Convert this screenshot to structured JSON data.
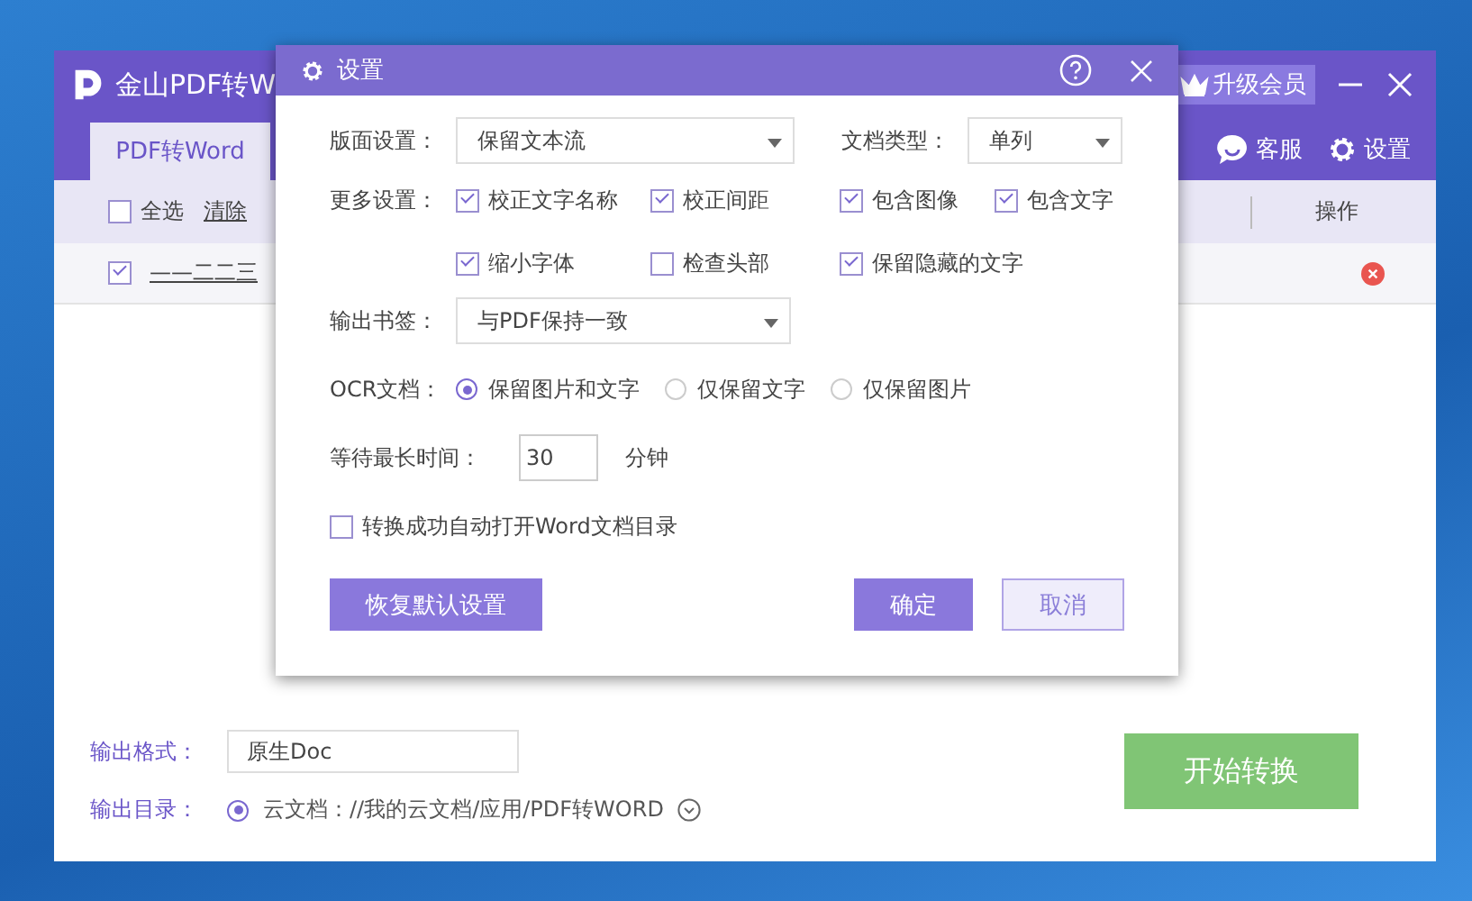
{
  "app": {
    "title": "金山PDF转W",
    "upgrade_label": "升级会员",
    "tabs": [
      {
        "label": "PDF转Word",
        "selected": true
      }
    ],
    "toolbar_links": [
      {
        "label": "客服",
        "kind": "chat"
      },
      {
        "label": "设置",
        "kind": "gear"
      }
    ],
    "select_all": {
      "label": "全选",
      "checked": false
    },
    "clear_label": "清除",
    "columns": [
      "操作"
    ],
    "files": [
      {
        "name": "——二二三",
        "checked": true
      }
    ],
    "output_format": {
      "label": "输出格式：",
      "value": "原生Doc"
    },
    "output_dir": {
      "label": "输出目录：",
      "option": "云文档：//我的云文档/应用/PDF转WORD",
      "selected": true
    },
    "start_button": "开始转换"
  },
  "dialog": {
    "title": "设置",
    "layout": {
      "label": "版面设置：",
      "value": "保留文本流"
    },
    "doc_type": {
      "label": "文档类型：",
      "value": "单列"
    },
    "more": {
      "label": "更多设置：",
      "options": [
        {
          "label": "校正文字名称",
          "checked": true
        },
        {
          "label": "校正间距",
          "checked": true
        },
        {
          "label": "包含图像",
          "checked": true
        },
        {
          "label": "包含文字",
          "checked": true
        },
        {
          "label": "缩小字体",
          "checked": true
        },
        {
          "label": "检查头部",
          "checked": false
        },
        {
          "label": "保留隐藏的文字",
          "checked": true
        }
      ]
    },
    "bookmark": {
      "label": "输出书签：",
      "value": "与PDF保持一致"
    },
    "ocr": {
      "label": "OCR文档：",
      "options": [
        {
          "label": "保留图片和文字",
          "selected": true
        },
        {
          "label": "仅保留文字",
          "selected": false
        },
        {
          "label": "仅保留图片",
          "selected": false
        }
      ]
    },
    "wait": {
      "label": "等待最长时间：",
      "value": "30",
      "unit": "分钟"
    },
    "auto_open": {
      "label": "转换成功自动打开Word文档目录",
      "checked": false
    },
    "restore_button": "恢复默认设置",
    "ok_button": "确定",
    "cancel_button": "取消"
  }
}
